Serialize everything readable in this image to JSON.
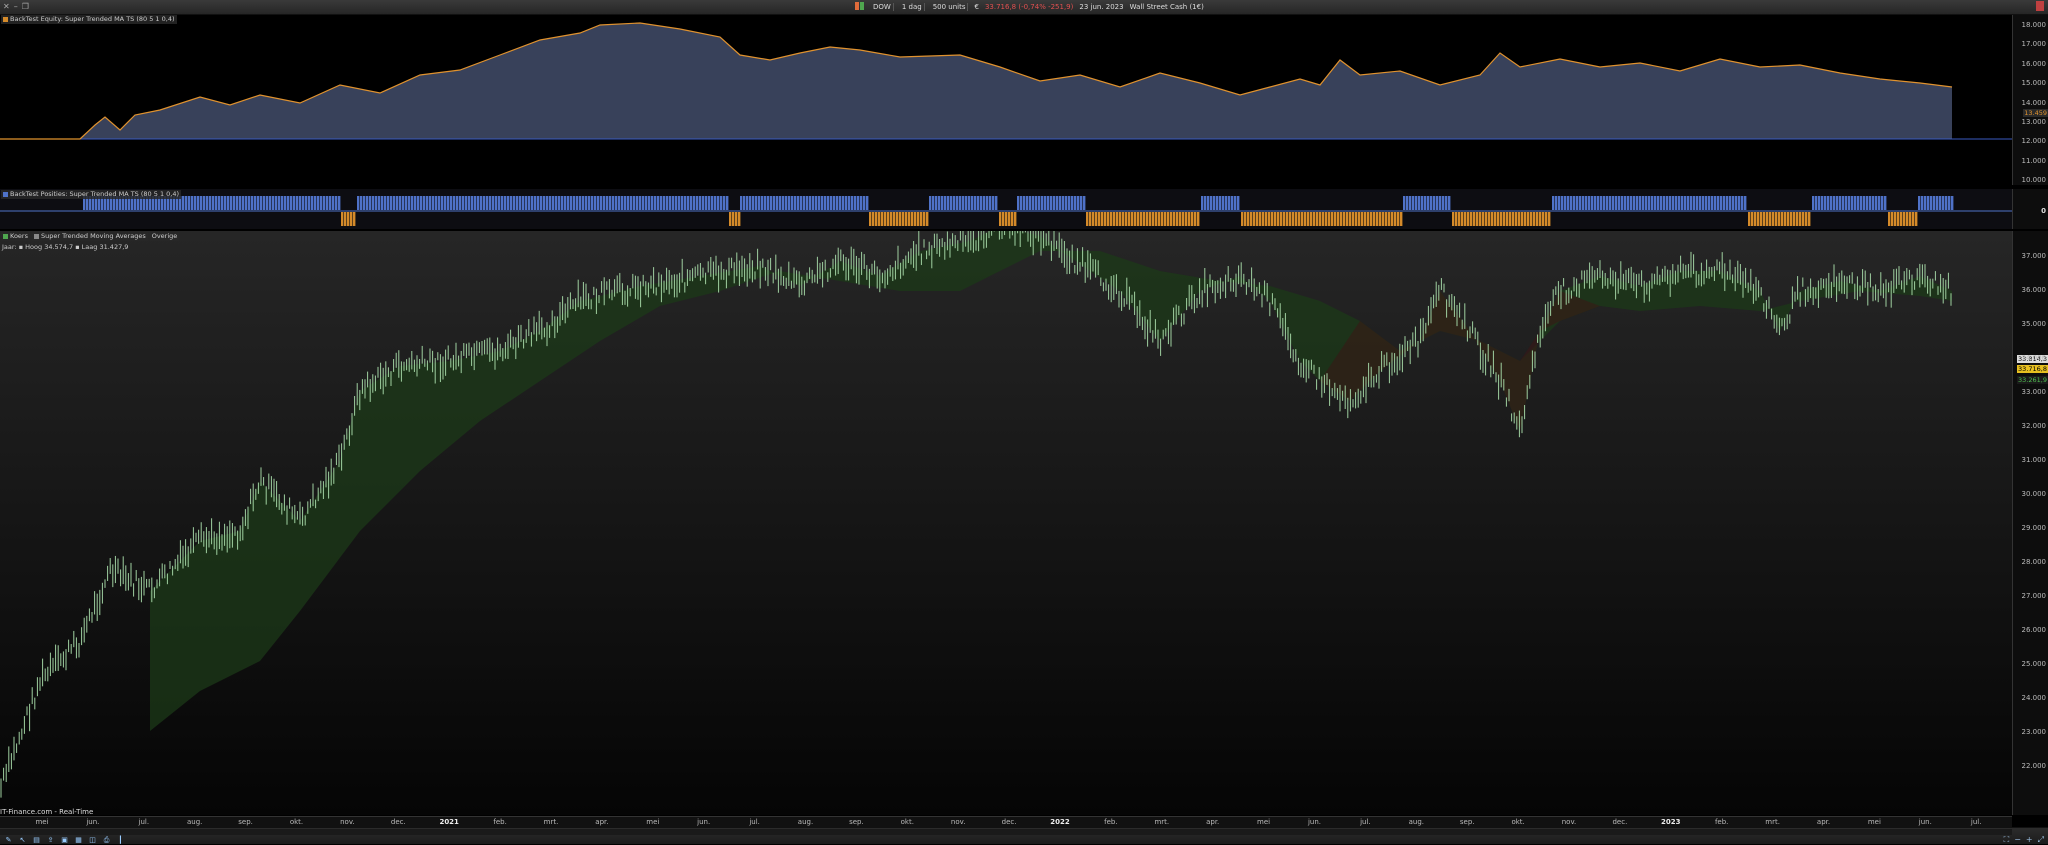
{
  "toolbar": {
    "instrument": "DOW",
    "timeframe": "1 dag",
    "units": "500 units",
    "quote": "33.716,8 (-0,74% -251,9)",
    "date": "23 jun. 2023",
    "market": "Wall Street Cash (1€)"
  },
  "equity_pane": {
    "label": "BackTest Equity: Super Trended MA TS (80 5 1 0,4)",
    "last_value": "13.459",
    "ticks": [
      "18.000",
      "17.000",
      "16.000",
      "15.000",
      "14.000",
      "13.000",
      "12.000",
      "11.000",
      "10.000"
    ]
  },
  "positions_pane": {
    "label": "BackTest Posities: Super Trended MA TS (80 5 1 0,4)",
    "zero": "0"
  },
  "price_pane": {
    "label_koers": "Koers",
    "label_indicator": "Super Trended Moving Averages",
    "label_overige": "Overige",
    "range": "Jaar: ▪ Hoog 34.574,7 ▪ Laag 31.427,9",
    "source": "IT-Finance.com - Real-Time",
    "tag_top": "33.814,3",
    "tag_price": "33.716,8",
    "tag_ma": "33.261,9",
    "ticks": [
      "37.000",
      "36.000",
      "35.000",
      "34.000",
      "33.000",
      "32.000",
      "31.000",
      "30.000",
      "29.000",
      "28.000",
      "27.000",
      "26.000",
      "25.000",
      "24.000",
      "23.000",
      "22.000"
    ]
  },
  "time_axis": [
    {
      "t": "mei",
      "y": false
    },
    {
      "t": "jun.",
      "y": false
    },
    {
      "t": "jul.",
      "y": false
    },
    {
      "t": "aug.",
      "y": false
    },
    {
      "t": "sep.",
      "y": false
    },
    {
      "t": "okt.",
      "y": false
    },
    {
      "t": "nov.",
      "y": false
    },
    {
      "t": "dec.",
      "y": false
    },
    {
      "t": "2021",
      "y": true
    },
    {
      "t": "feb.",
      "y": false
    },
    {
      "t": "mrt.",
      "y": false
    },
    {
      "t": "apr.",
      "y": false
    },
    {
      "t": "mei",
      "y": false
    },
    {
      "t": "jun.",
      "y": false
    },
    {
      "t": "jul.",
      "y": false
    },
    {
      "t": "aug.",
      "y": false
    },
    {
      "t": "sep.",
      "y": false
    },
    {
      "t": "okt.",
      "y": false
    },
    {
      "t": "nov.",
      "y": false
    },
    {
      "t": "dec.",
      "y": false
    },
    {
      "t": "2022",
      "y": true
    },
    {
      "t": "feb.",
      "y": false
    },
    {
      "t": "mrt.",
      "y": false
    },
    {
      "t": "apr.",
      "y": false
    },
    {
      "t": "mei",
      "y": false
    },
    {
      "t": "jun.",
      "y": false
    },
    {
      "t": "jul.",
      "y": false
    },
    {
      "t": "aug.",
      "y": false
    },
    {
      "t": "sep.",
      "y": false
    },
    {
      "t": "okt.",
      "y": false
    },
    {
      "t": "nov.",
      "y": false
    },
    {
      "t": "dec.",
      "y": false
    },
    {
      "t": "2023",
      "y": true
    },
    {
      "t": "feb.",
      "y": false
    },
    {
      "t": "mrt.",
      "y": false
    },
    {
      "t": "apr.",
      "y": false
    },
    {
      "t": "mei",
      "y": false
    },
    {
      "t": "jun.",
      "y": false
    },
    {
      "t": "jul.",
      "y": false
    }
  ],
  "colors": {
    "long": "#4f72c8",
    "short": "#d48a2a",
    "equity_line": "#e0922e",
    "equity_fill": "#38415a",
    "up": "#9fd0a0",
    "green_band": "#1c3a18",
    "red_band": "#3a1616"
  }
}
